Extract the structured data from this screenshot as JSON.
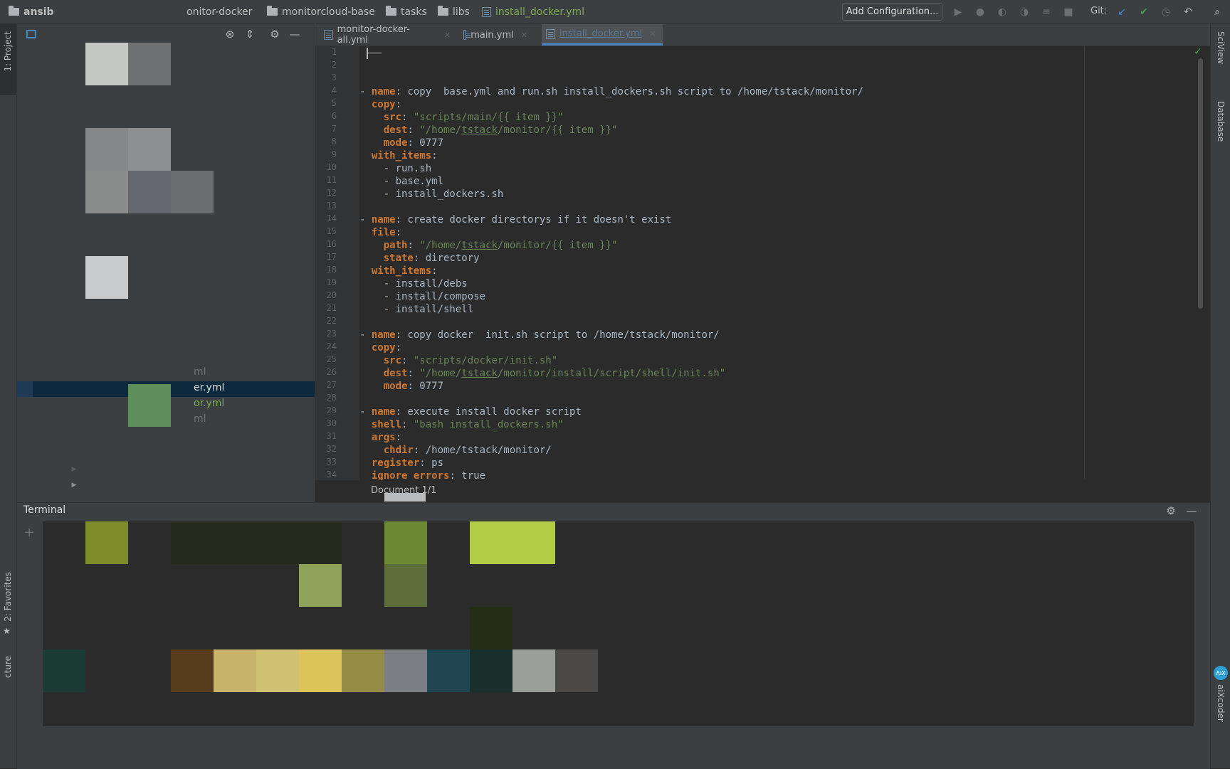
{
  "navbar": {
    "crumbs": [
      "ansib",
      "onitor-docker",
      "monitorcloud-base",
      "tasks",
      "libs",
      "install_docker.yml"
    ],
    "add_configuration": "Add Configuration...",
    "git_label": "Git:"
  },
  "left_stripe": {
    "project": "1: Project",
    "favorites": "2: Favorites",
    "structure": "cture"
  },
  "right_stripe": {
    "sciview": "SciView",
    "database": "Database",
    "aixcoder": "aiXcoder",
    "aixcoder_badge": "AiX"
  },
  "project_panel": {
    "items": [
      {
        "label": "ml"
      },
      {
        "label": "er.yml"
      },
      {
        "label": "or.yml"
      },
      {
        "label": "ml"
      }
    ]
  },
  "editor": {
    "tabs": [
      {
        "label": "monitor-docker-all.yml"
      },
      {
        "label": "main.yml"
      },
      {
        "label": "install_docker.yml"
      }
    ],
    "status": "Document 1/1"
  },
  "terminal": {
    "title": "Terminal",
    "add": "+"
  },
  "colors": {
    "background": "#2b2b2b",
    "panel": "#3c3f41",
    "keyword": "#cc7832",
    "string": "#6a8759",
    "text": "#a9b7c6",
    "accent": "#4a88c7",
    "ok_green": "#499c54"
  },
  "icons": [
    "folder-icon",
    "yaml-file-icon",
    "run-icon",
    "debug-icon",
    "git-update-icon",
    "git-commit-icon",
    "undo-icon",
    "search-icon",
    "gear-icon",
    "minimize-icon",
    "collapse-all-icon",
    "locate-icon",
    "check-icon",
    "star-icon",
    "close-icon"
  ]
}
